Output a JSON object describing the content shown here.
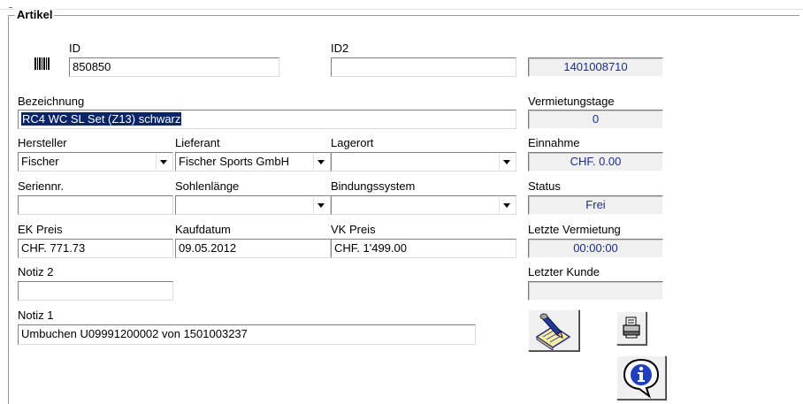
{
  "group": {
    "title": "Artikel"
  },
  "labels": {
    "id": "ID",
    "id2": "ID2",
    "bezeichnung": "Bezeichnung",
    "hersteller": "Hersteller",
    "lieferant": "Lieferant",
    "lagerort": "Lagerort",
    "seriennr": "Seriennr.",
    "sohlenlaenge": "Sohlenlänge",
    "bindungssystem": "Bindungssystem",
    "ek_preis": "EK Preis",
    "kaufdatum": "Kaufdatum",
    "vk_preis": "VK Preis",
    "notiz2": "Notiz 2",
    "notiz1": "Notiz 1",
    "vermietungstage": "Vermietungstage",
    "einnahme": "Einnahme",
    "status": "Status",
    "letzte_vermietung": "Letzte Vermietung",
    "letzter_kunde": "Letzter Kunde"
  },
  "fields": {
    "id": "850850",
    "id2": "",
    "bezeichnung": "RC4 WC SL Set (Z13) schwarz",
    "hersteller": "Fischer",
    "lieferant": "Fischer Sports GmbH",
    "lagerort": "",
    "seriennr": "",
    "sohlenlaenge": "",
    "bindungssystem": "",
    "ek_preis": "CHF. 771.73",
    "kaufdatum": "09.05.2012",
    "vk_preis": "CHF. 1'499.00",
    "notiz2": "",
    "notiz1": "Umbuchen  U09991200002 von 1501003237"
  },
  "readonly": {
    "id3": "1401008710",
    "vermietungstage": "0",
    "einnahme": "CHF. 0.00",
    "status": "Frei",
    "letzte_vermietung": "00:00:00",
    "letzter_kunde": ""
  },
  "icons": {
    "barcode": "barcode-icon",
    "edit": "notepad-pen-icon",
    "print": "printer-icon",
    "info": "info-icon"
  },
  "colors": {
    "selection_bg": "#0a246a",
    "readonly_text": "#1a2e8a",
    "readonly_bg": "#f0f0f0"
  }
}
